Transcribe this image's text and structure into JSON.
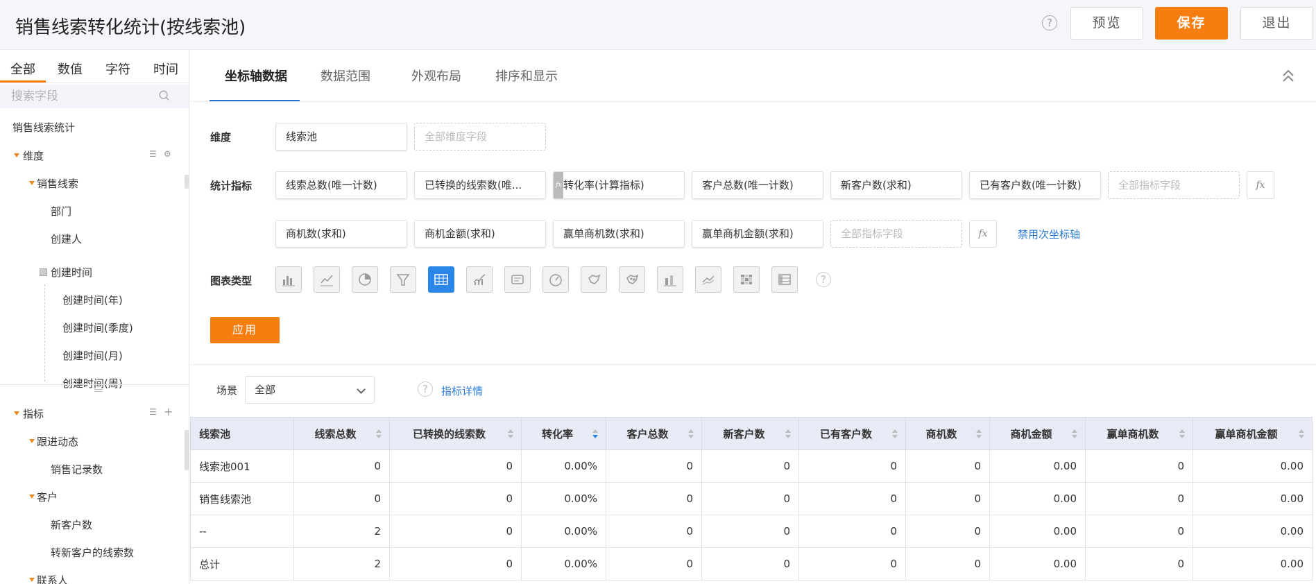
{
  "header": {
    "title": "销售线索转化统计(按线索池)",
    "preview": "预览",
    "save": "保存",
    "exit": "退出",
    "help": "?"
  },
  "sidebar": {
    "tabs": [
      "全部",
      "数值",
      "字符",
      "时间"
    ],
    "search_placeholder": "搜索字段",
    "root": "销售线索统计",
    "dimension_label": "维度",
    "dim_group": "销售线索",
    "dim_items": [
      "部门",
      "创建人"
    ],
    "time_group": "创建时间",
    "time_items": [
      "创建时间(年)",
      "创建时间(季度)",
      "创建时间(月)",
      "创建时间(周)"
    ],
    "metric_label": "指标",
    "metric_groups": [
      {
        "name": "跟进动态",
        "items": [
          "销售记录数"
        ]
      },
      {
        "name": "客户",
        "items": [
          "新客户数",
          "转新客户的线索数"
        ]
      },
      {
        "name": "联系人",
        "items": []
      }
    ]
  },
  "main": {
    "tabs": [
      "坐标轴数据",
      "数据范围",
      "外观布局",
      "排序和显示"
    ],
    "dimension": {
      "label": "维度",
      "value": "线索池",
      "placeholder": "全部维度字段"
    },
    "metrics": {
      "label": "统计指标",
      "row1": [
        "线索总数(唯一计数)",
        "已转换的线索数(唯...",
        "转化率(计算指标)",
        "客户总数(唯一计数)",
        "新客户数(求和)",
        "已有客户数(唯一计数)"
      ],
      "row2": [
        "商机数(求和)",
        "商机金额(求和)",
        "赢单商机数(求和)",
        "赢单商机金额(求和)"
      ],
      "placeholder": "全部指标字段",
      "fx": "fx",
      "fx_tag": "fx",
      "disable_secondary": "禁用次坐标轴"
    },
    "chart_type": {
      "label": "图表类型",
      "icons": [
        "bar-chart-icon",
        "line-chart-icon",
        "pie-chart-icon",
        "funnel-chart-icon",
        "table-chart-icon",
        "area-chart-icon",
        "card-chart-icon",
        "gauge-chart-icon",
        "map-chart-icon",
        "scatter-map-icon",
        "stacked-bar-icon",
        "dual-line-icon",
        "heatmap-icon",
        "pivot-table-icon"
      ],
      "selected": 4
    },
    "apply": "应用",
    "scene": {
      "label": "场景",
      "value": "全部"
    },
    "metric_detail": "指标详情"
  },
  "table": {
    "headers": [
      "线索池",
      "线索总数",
      "已转换的线索数",
      "转化率",
      "客户总数",
      "新客户数",
      "已有客户数",
      "商机数",
      "商机金额",
      "赢单商机数",
      "赢单商机金额"
    ],
    "rows": [
      [
        "线索池001",
        "0",
        "0",
        "0.00%",
        "0",
        "0",
        "0",
        "0",
        "0.00",
        "0",
        "0.00"
      ],
      [
        "销售线索池",
        "0",
        "0",
        "0.00%",
        "0",
        "0",
        "0",
        "0",
        "0.00",
        "0",
        "0.00"
      ],
      [
        "--",
        "2",
        "0",
        "0.00%",
        "0",
        "0",
        "0",
        "0",
        "0.00",
        "0",
        "0.00"
      ],
      [
        "总计",
        "2",
        "0",
        "0.00%",
        "0",
        "0",
        "0",
        "0",
        "0.00",
        "0",
        "0.00"
      ]
    ]
  },
  "colors": {
    "accent": "#f67e10",
    "primary_blue": "#2a86e8",
    "link": "#2a7ad8"
  }
}
